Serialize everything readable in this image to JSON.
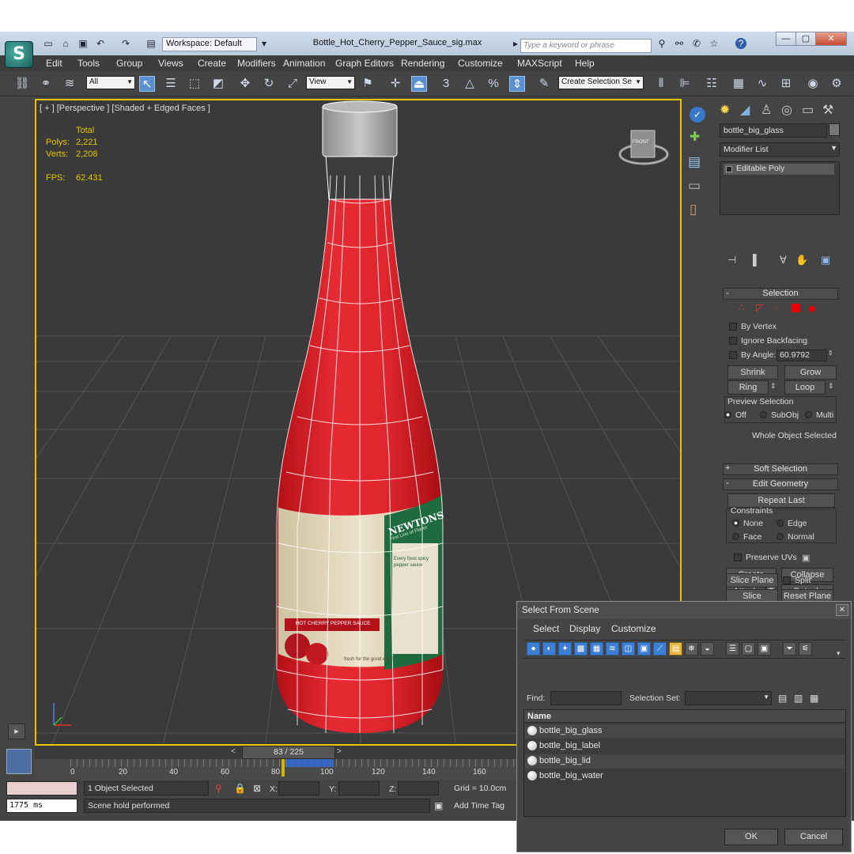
{
  "window": {
    "workspace": "Workspace: Default",
    "filename": "Bottle_Hot_Cherry_Pepper_Sauce_sig.max",
    "search_placeholder": "Type a keyword or phrase"
  },
  "menu": [
    "Edit",
    "Tools",
    "Group",
    "Views",
    "Create",
    "Modifiers",
    "Animation",
    "Graph Editors",
    "Rendering",
    "Customize",
    "MAXScript",
    "Help"
  ],
  "toolbar": {
    "selection_filter": "All",
    "reference_coord": "View",
    "named_selection": "Create Selection Se",
    "snap_label": "3",
    "percent_label": "%"
  },
  "viewport": {
    "label": "[ + ] [Perspective ] [Shaded + Edged Faces ]",
    "stats_header": "Total",
    "polys_label": "Polys:",
    "polys_value": "2,221",
    "verts_label": "Verts:",
    "verts_value": "2,208",
    "fps_label": "FPS:",
    "fps_value": "62.431",
    "viewcube_label": "FRONT",
    "label_text": {
      "brand": "NEWTONS",
      "sauce": "HOT CHERRY PEPPER SAUCE",
      "tagline": "First Line of Flavor",
      "body": "Every food spicy pepper sauce",
      "footer": "fresh for the good eats!"
    }
  },
  "command_panel": {
    "object_name": "bottle_big_glass",
    "modifier_list": "Modifier List",
    "stack_item": "Editable Poly",
    "selection_title": "Selection",
    "by_vertex": "By Vertex",
    "ignore_backfacing": "Ignore Backfacing",
    "by_angle": "By Angle:",
    "angle_value": "60.9792",
    "shrink": "Shrink",
    "grow": "Grow",
    "ring": "Ring",
    "loop": "Loop",
    "preview_selection": "Preview Selection",
    "preview_off": "Off",
    "preview_subobj": "SubObj",
    "preview_multi": "Multi",
    "whole_object": "Whole Object Selected",
    "soft_selection": "Soft Selection",
    "edit_geometry": "Edit Geometry",
    "repeat_last": "Repeat Last",
    "constraints": "Constraints",
    "c_none": "None",
    "c_edge": "Edge",
    "c_face": "Face",
    "c_normal": "Normal",
    "preserve_uvs": "Preserve UVs",
    "create": "Create",
    "collapse": "Collapse",
    "attach": "Attach",
    "detach": "Detach",
    "slice_plane": "Slice Plane",
    "split": "Split",
    "slice": "Slice",
    "reset_plane": "Reset Plane",
    "accent_color": "#e60000"
  },
  "timeline": {
    "frame_display": "83 / 225",
    "frame_value": 83,
    "frame_total": 225,
    "ticks": [
      "0",
      "20",
      "40",
      "60",
      "80",
      "100",
      "120",
      "140",
      "160"
    ]
  },
  "status": {
    "objects_selected": "1 Object Selected",
    "x_label": "X:",
    "y_label": "Y:",
    "z_label": "Z:",
    "grid": "Grid = 10.0cm",
    "time_ms": "1775 ms",
    "prompt": "Scene hold performed",
    "add_time_tag": "Add Time Tag"
  },
  "dialog": {
    "title": "Select From Scene",
    "menu": [
      "Select",
      "Display",
      "Customize"
    ],
    "find_label": "Find:",
    "selection_set_label": "Selection Set:",
    "column_name": "Name",
    "items": [
      "bottle_big_glass",
      "bottle_big_label",
      "bottle_big_lid",
      "bottle_big_water"
    ],
    "ok": "OK",
    "cancel": "Cancel"
  }
}
